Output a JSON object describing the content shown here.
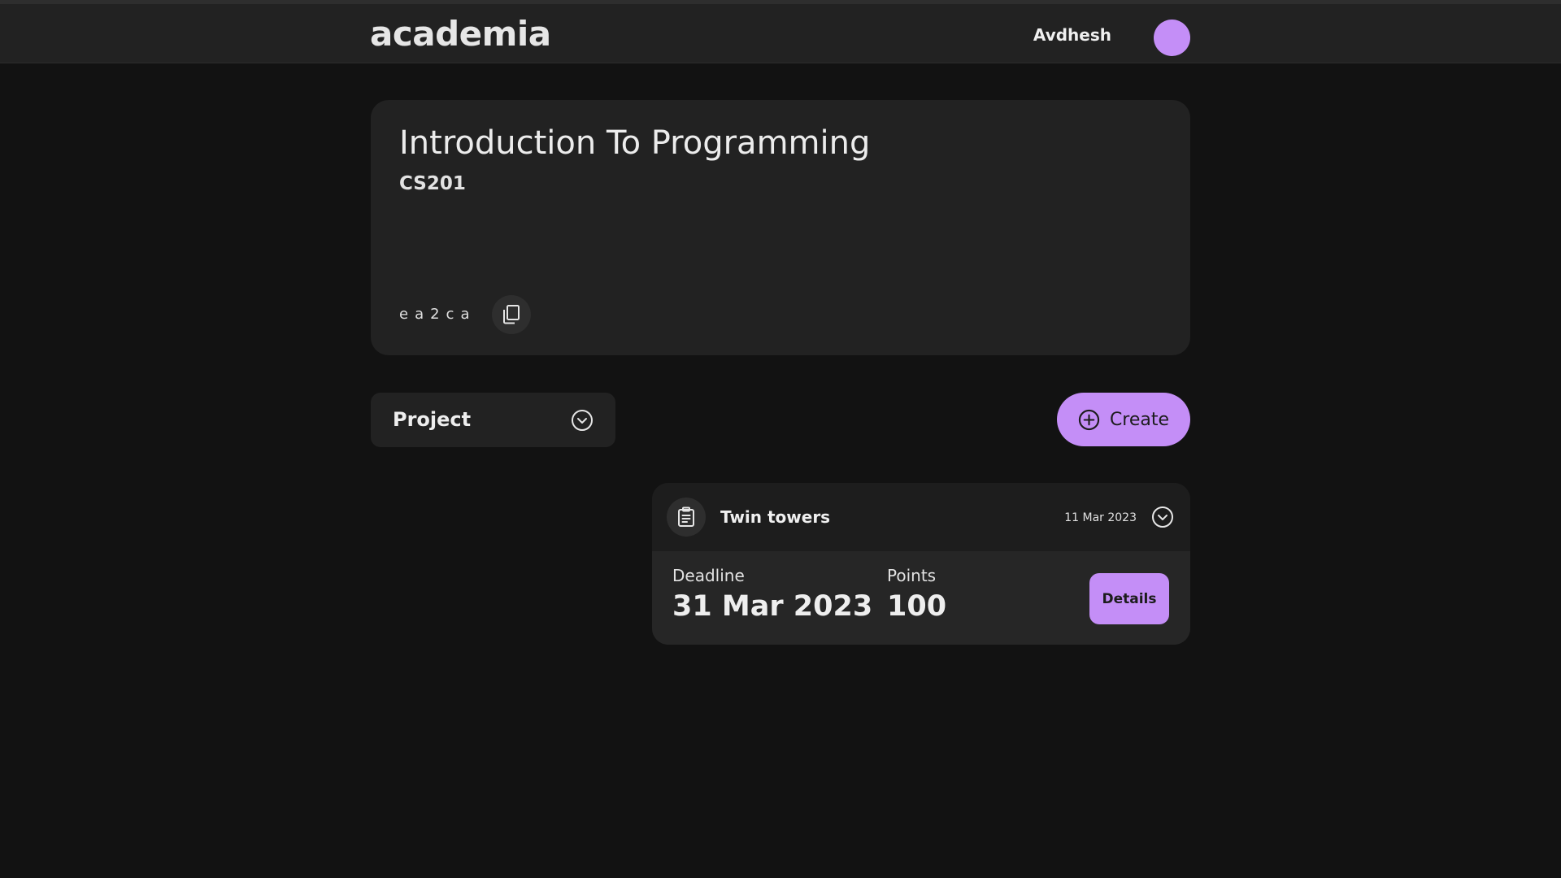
{
  "header": {
    "logo": "academia",
    "user_name": "Avdhesh",
    "avatar_color": "#c48ef7"
  },
  "course": {
    "title": "Introduction To Programming",
    "code": "CS201",
    "class_code": "ea2ca",
    "copy_icon": "copy-icon"
  },
  "toolbar": {
    "filter_label": "Project",
    "filter_icon": "chevron-down-circle-icon",
    "create_label": "Create",
    "create_icon": "plus-circle-icon"
  },
  "assignment": {
    "icon": "clipboard-icon",
    "title": "Twin towers",
    "posted_date": "11 Mar 2023",
    "toggle_icon": "chevron-down-circle-icon",
    "deadline_label": "Deadline",
    "deadline_value": "31 Mar 2023",
    "points_label": "Points",
    "points_value": "100",
    "details_label": "Details"
  },
  "colors": {
    "accent": "#c48ef7",
    "background": "#121212",
    "card": "#222222"
  }
}
